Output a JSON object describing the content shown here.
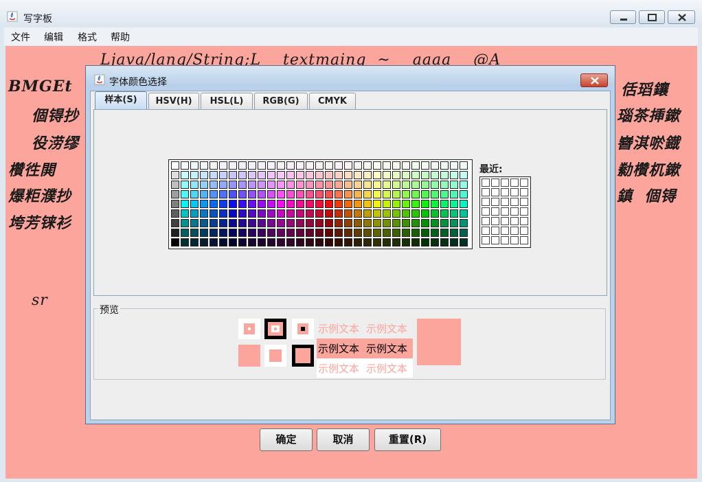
{
  "window": {
    "title": "写字板",
    "menus": [
      "文件",
      "编辑",
      "格式",
      "帮助"
    ]
  },
  "editor": {
    "background": "#fca59d",
    "lines": [
      "Ljava/lang/String;L    textmaing  ~    aaaa    @A",
      "BMGEt",
      "個锝抄",
      "役涝缪",
      "欑徃閧",
      "爆粔濮抄",
      "垮芳铼衫",
      "sr",
      "佸瑫鑲",
      "瑙茶挿鏉",
      "嶜淇唹鐡",
      "勬欑杌鏉",
      "鎮  個锝"
    ]
  },
  "dialog": {
    "title": "字体颜色选择",
    "tabs": [
      "样本(S)",
      "HSV(H)",
      "HSL(L)",
      "RGB(G)",
      "CMYK"
    ],
    "selected_tab": "样本(S)",
    "recent_label": "最近:",
    "preview_label": "预览",
    "sample_text": "示例文本",
    "preview_color": "#fca59d",
    "buttons": {
      "ok": "确定",
      "cancel": "取消",
      "reset": "重置(R)"
    }
  }
}
